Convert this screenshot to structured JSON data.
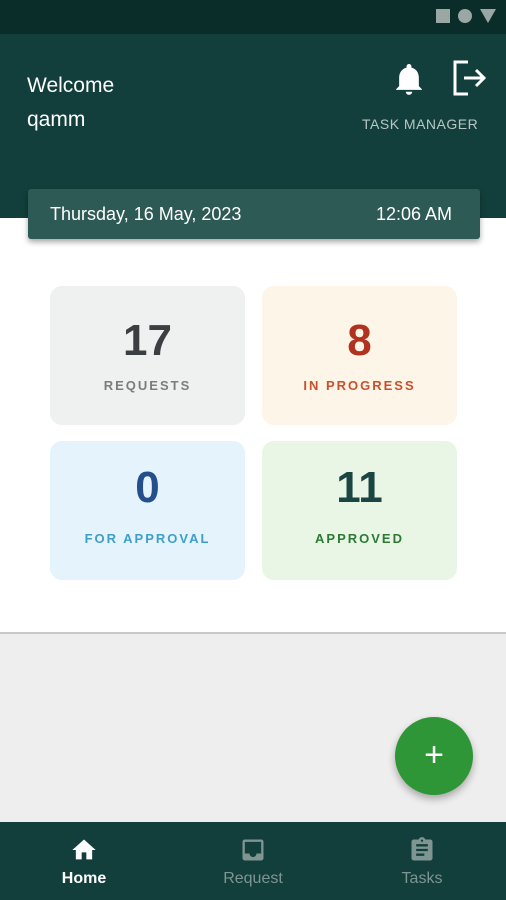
{
  "header": {
    "welcome_label": "Welcome",
    "username": "qamm",
    "task_manager_label": "TASK MANAGER"
  },
  "date_bar": {
    "date": "Thursday, 16 May, 2023",
    "time": "12:06 AM"
  },
  "stats": {
    "requests": {
      "count": "17",
      "label": "REQUESTS"
    },
    "in_progress": {
      "count": "8",
      "label": "IN PROGRESS"
    },
    "for_approval": {
      "count": "0",
      "label": "FOR APPROVAL"
    },
    "approved": {
      "count": "11",
      "label": "APPROVED"
    }
  },
  "fab": {
    "label": "+"
  },
  "nav": {
    "home": "Home",
    "request": "Request",
    "tasks": "Tasks"
  },
  "colors": {
    "header_bg": "#123f3b",
    "fab_bg": "#2e9636"
  }
}
